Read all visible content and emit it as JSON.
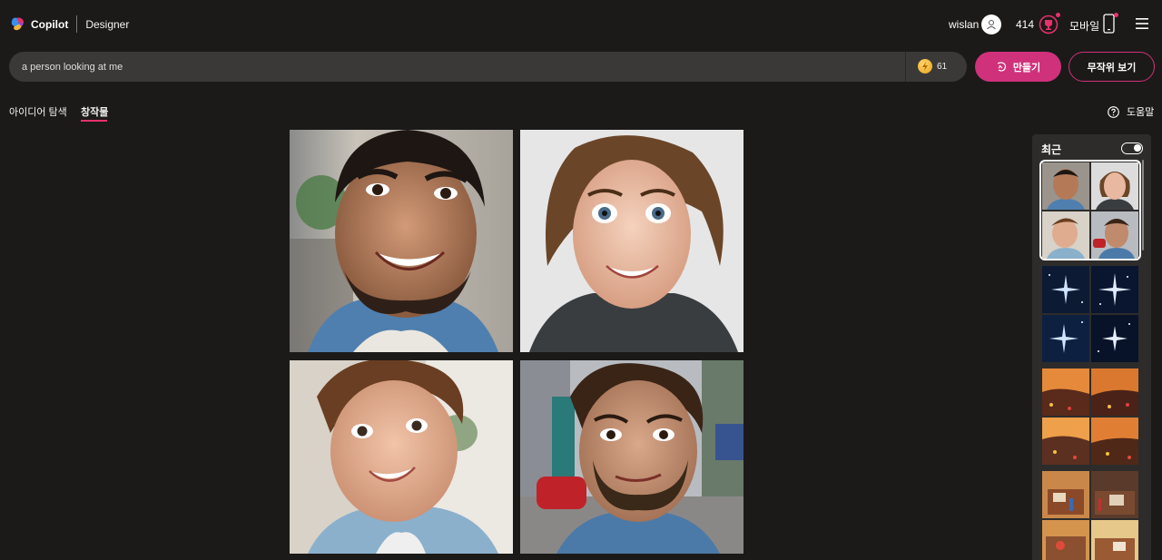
{
  "header": {
    "brand_name": "Copilot",
    "product_name": "Designer",
    "user_name": "wislan",
    "points": "414",
    "mobile_label": "모바일"
  },
  "prompt": {
    "value": "a person looking at me",
    "boost_count": "61",
    "create_label": "만들기",
    "surprise_label": "무작위 보기"
  },
  "tabs": [
    {
      "label": "아이디어 탐색",
      "active": false
    },
    {
      "label": "창작물",
      "active": true
    }
  ],
  "help_label": "도움말",
  "recent": {
    "title": "최근",
    "toggle_on": true,
    "sets": [
      {
        "theme": "portraits",
        "selected": true
      },
      {
        "theme": "starry-sky",
        "selected": false
      },
      {
        "theme": "sunset-flower-field",
        "selected": false
      },
      {
        "theme": "art-desk",
        "selected": false
      }
    ]
  },
  "colors": {
    "accent": "#d0317b",
    "background": "#1b1a19",
    "input_bg": "#3a3938",
    "panel_bg": "#2d2c2b"
  },
  "icons": [
    "copilot-logo-icon",
    "user-avatar-icon",
    "rewards-trophy-icon",
    "mobile-phone-icon",
    "hamburger-menu-icon",
    "boost-coin-icon",
    "create-sparkle-icon",
    "help-circle-icon",
    "toggle-icon"
  ]
}
